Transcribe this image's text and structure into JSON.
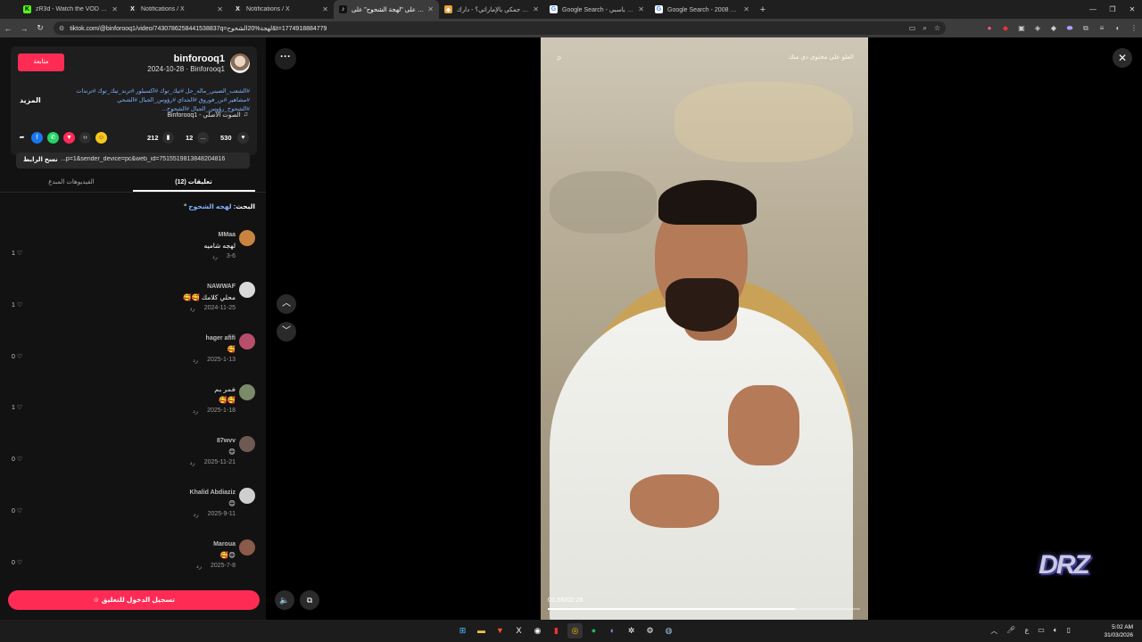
{
  "browser": {
    "tabs": [
      {
        "title": "zR3d - Watch the VOD on Kick",
        "favicon_color": "#53fc18",
        "glyph": "K",
        "active": false
      },
      {
        "title": "Notifications / X",
        "favicon_color": "#222222",
        "glyph": "X",
        "active": false
      },
      {
        "title": "Notifications / X",
        "favicon_color": "#222222",
        "glyph": "X",
        "active": false
      },
      {
        "title": "العلر على \"لهجة الشحوح\" على",
        "favicon_color": "#111111",
        "glyph": "♪",
        "active": true
      },
      {
        "title": "ما معنى جمكي بالإماراتي؟ - دارك",
        "favicon_color": "#e8a33b",
        "glyph": "◆",
        "active": false
      },
      {
        "title": "Google Search - حمود باسبي",
        "favicon_color": "#ffffff",
        "glyph": "G",
        "active": false
      },
      {
        "title": "Google Search - 2008 اكزس",
        "favicon_color": "#ffffff",
        "glyph": "G",
        "active": false
      }
    ],
    "url": "tiktok.com/@binforooq1/video/7430786258441538837q=لهجة%20الشحوح&t=1774918884779"
  },
  "post": {
    "username": "binforooq1",
    "date_line": "2024-10-28 · Binforooq1",
    "follow_label": "متابعة",
    "hashtags": "#الشعب_الصيني_ماله_حل #تيك_توك #اكسبلور #ترند_تيك_توك #ترندات #مشاهير #بن_فوروق #الجداي #رؤوس_الجبال #الشحي #الشحوح_رؤوس_الجبال #الشحوح...",
    "more_label": "المزيد",
    "music": "الصوت الأصلي - Binforooq1",
    "likes": "530",
    "comments_count": "12",
    "saves": "212",
    "link_text": "...p=1&sender_device=pc&web_id=7515519813848204816",
    "copy_label": "نسخ الرابط"
  },
  "tabs2": {
    "comments": "تعليقات (12)",
    "creator_videos": "الفيديوهات المبدع"
  },
  "search_tag": {
    "prefix": "البحث:",
    "term": "لهجه الشحوح"
  },
  "comments": [
    {
      "name": "MMaa",
      "text": "لهجه شاميه",
      "date": "3-6",
      "reply": "رد",
      "likes": "1 ♡",
      "avatar": "#c9833f"
    },
    {
      "name": "NAWWAF",
      "text": "محلي كلامك 🥰🥰",
      "date": "2024-11-25",
      "reply": "رد",
      "likes": "1 ♡",
      "avatar": "#d9d9d9"
    },
    {
      "name": "hager afifi",
      "text": "🥰",
      "date": "2025-1-13",
      "reply": "رد",
      "likes": "0 ♡",
      "avatar": "#b84f6a"
    },
    {
      "name": "قمر يم",
      "text": "🥰🥰",
      "date": "2025-1-18",
      "reply": "رد",
      "likes": "1 ♡",
      "avatar": "#7a8a6a"
    },
    {
      "name": "87wvv",
      "text": "😊",
      "date": "2025-11-21",
      "reply": "رد",
      "likes": "0 ♡",
      "avatar": "#6e5a52"
    },
    {
      "name": "Khalid Abdiaziz",
      "text": "😊",
      "date": "2025-9-11",
      "reply": "رد",
      "likes": "0 ♡",
      "avatar": "#cfcfcf"
    },
    {
      "name": "Maroua",
      "text": "😊🥰",
      "date": "2025-7-8",
      "reply": "رد",
      "likes": "0 ♡",
      "avatar": "#8a5a4a"
    }
  ],
  "login_label": "تسجيل الدخول للتعليق",
  "video": {
    "caption": "العلو على محتوى دي منك",
    "time": "01:55/02:26",
    "progress": 0.79
  },
  "watermark": "DRZ",
  "clock": {
    "time": "5:02 AM",
    "date": "31/03/2026"
  },
  "tray_lang": "ع"
}
